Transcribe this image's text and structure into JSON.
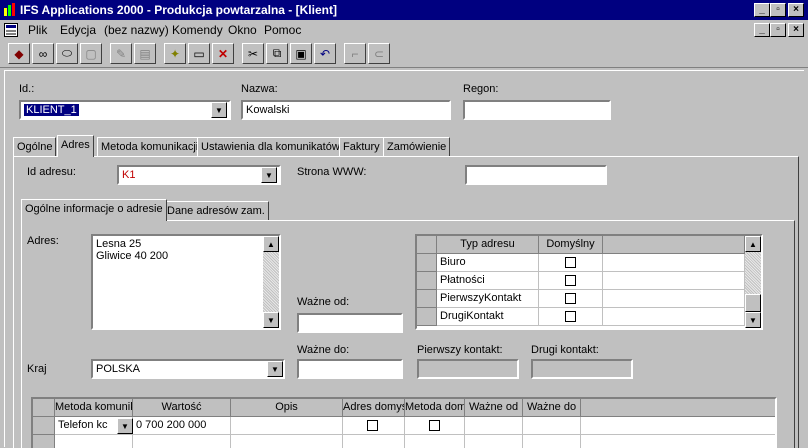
{
  "window": {
    "title": "IFS Applications 2000 - Produkcja powtarzalna - [Klient]"
  },
  "menu": [
    {
      "label": "Plik"
    },
    {
      "label": "Edycja"
    },
    {
      "label": "(bez nazwy)"
    },
    {
      "label": "Komendy"
    },
    {
      "label": "Okno"
    },
    {
      "label": "Pomoc"
    }
  ],
  "header": {
    "id_label": "Id.:",
    "id_value": "KLIENT_1",
    "name_label": "Nazwa:",
    "name_value": "Kowalski",
    "regon_label": "Regon:",
    "regon_value": ""
  },
  "tabs": [
    {
      "label": "Ogólne"
    },
    {
      "label": "Adres"
    },
    {
      "label": "Metoda komunikacji"
    },
    {
      "label": "Ustawienia dla komunikatów"
    },
    {
      "label": "Faktury"
    },
    {
      "label": "Zamówienie"
    }
  ],
  "address": {
    "id_label": "Id adresu:",
    "id_value": "K1",
    "www_label": "Strona WWW:",
    "www_value": "",
    "subtabs": [
      {
        "label": "Ogólne informacje o adresie"
      },
      {
        "label": "Dane adresów zam."
      }
    ],
    "adres_label": "Adres:",
    "adres_lines": [
      "Lesna 25",
      "Gliwice 40 200"
    ],
    "valid_from_label": "Ważne od:",
    "valid_from_value": "",
    "valid_to_label": "Ważne do:",
    "valid_to_value": "",
    "first_contact_label": "Pierwszy kontakt:",
    "first_contact_value": "",
    "second_contact_label": "Drugi kontakt:",
    "second_contact_value": "",
    "country_label": "Kraj",
    "country_value": "POLSKA",
    "types_table": {
      "headers": [
        "Typ adresu",
        "Domyślny"
      ],
      "rows": [
        {
          "type": "Biuro",
          "default": false
        },
        {
          "type": "Płatności",
          "default": false
        },
        {
          "type": "PierwszyKontakt",
          "default": false
        },
        {
          "type": "DrugiKontakt",
          "default": false
        }
      ]
    }
  },
  "comm_table": {
    "headers": [
      "Metoda komunik",
      "Wartość",
      "Opis",
      "Adres domyś",
      "Metoda dom",
      "Ważne od",
      "Ważne do"
    ],
    "rows": [
      {
        "method": "Telefon kc",
        "value": "0 700 200 000",
        "desc": "",
        "addr_default": false,
        "method_default": false,
        "valid_from": "",
        "valid_to": ""
      }
    ]
  }
}
